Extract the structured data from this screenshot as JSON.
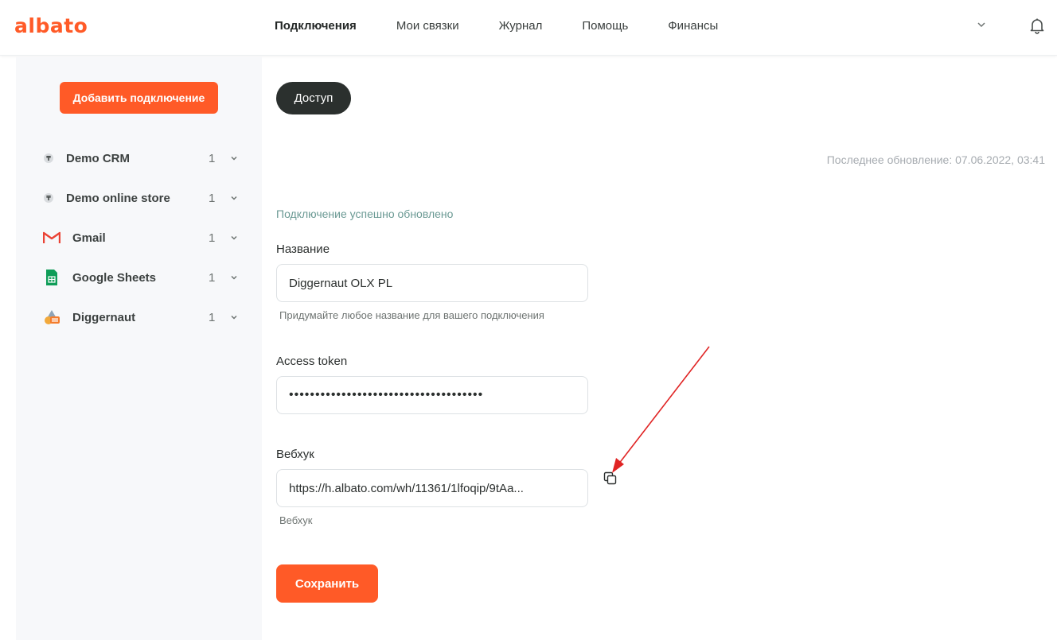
{
  "app": {
    "logo": "albato"
  },
  "nav": {
    "items": [
      {
        "label": "Подключения",
        "active": true
      },
      {
        "label": "Мои связки",
        "active": false
      },
      {
        "label": "Журнал",
        "active": false
      },
      {
        "label": "Помощь",
        "active": false
      },
      {
        "label": "Финансы",
        "active": false
      }
    ],
    "icons": [
      "chevron-down-icon",
      "bell-icon"
    ]
  },
  "sidebar": {
    "add_button": "Добавить подключение",
    "connections": [
      {
        "label": "Demo CRM",
        "count": "1",
        "icon": "demo-icon"
      },
      {
        "label": "Demo online store",
        "count": "1",
        "icon": "demo-icon"
      },
      {
        "label": "Gmail",
        "count": "1",
        "icon": "gmail-icon"
      },
      {
        "label": "Google Sheets",
        "count": "1",
        "icon": "google-sheets-icon"
      },
      {
        "label": "Diggernaut",
        "count": "1",
        "icon": "diggernaut-icon"
      }
    ]
  },
  "main": {
    "access_button": "Доступ",
    "last_update": "Последнее обновление: 07.06.2022, 03:41",
    "success_message": "Подключение успешно обновлено",
    "name_label": "Название",
    "name_value": "Diggernaut OLX PL",
    "name_hint": "Придумайте любое название для вашего подключения",
    "token_label": "Access token",
    "token_value": "•••••••••••••••••••••••••••••••••••••",
    "webhook_label": "Вебхук",
    "webhook_value": "https://h.albato.com/wh/11361/1lfoqip/9tAa...",
    "webhook_hint": "Вебхук",
    "save_button": "Сохранить"
  },
  "colors": {
    "brand_orange": "#ff5a27",
    "dark_button": "#2b302e",
    "success_text": "#6b9a94",
    "annotation_arrow": "#e02424"
  }
}
